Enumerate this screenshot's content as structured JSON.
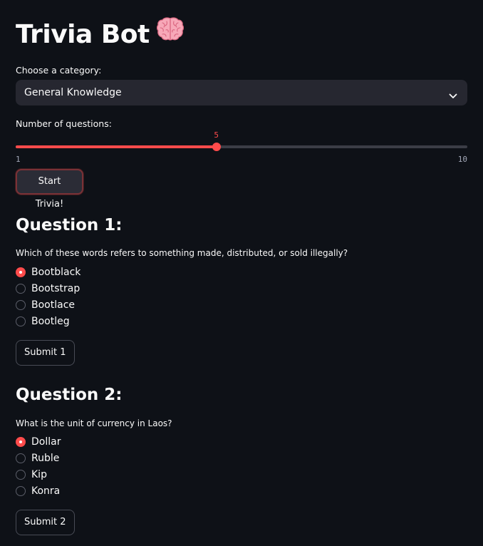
{
  "app": {
    "title": "Trivia Bot",
    "title_icon": "brain-icon"
  },
  "category": {
    "label": "Choose a category:",
    "selected": "General Knowledge"
  },
  "questions_slider": {
    "label": "Number of questions:",
    "value": "5",
    "min": "1",
    "max": "10",
    "fill_fraction": 0.4444,
    "accent": "#ff4b4b"
  },
  "start_button": {
    "label": "Start Trivia!"
  },
  "questions": [
    {
      "heading": "Question 1:",
      "text": "Which of these words refers to something made, distributed, or sold illegally?",
      "options": [
        "Bootblack",
        "Bootstrap",
        "Bootlace",
        "Bootleg"
      ],
      "selected_index": 0,
      "submit_label": "Submit 1"
    },
    {
      "heading": "Question 2:",
      "text": "What is the unit of currency in Laos?",
      "options": [
        "Dollar",
        "Ruble",
        "Kip",
        "Konra"
      ],
      "selected_index": 0,
      "submit_label": "Submit 2"
    }
  ],
  "colors": {
    "background": "#0e1117",
    "accent": "#ff4b4b",
    "input_bg": "#262730",
    "text": "#fafafa"
  }
}
